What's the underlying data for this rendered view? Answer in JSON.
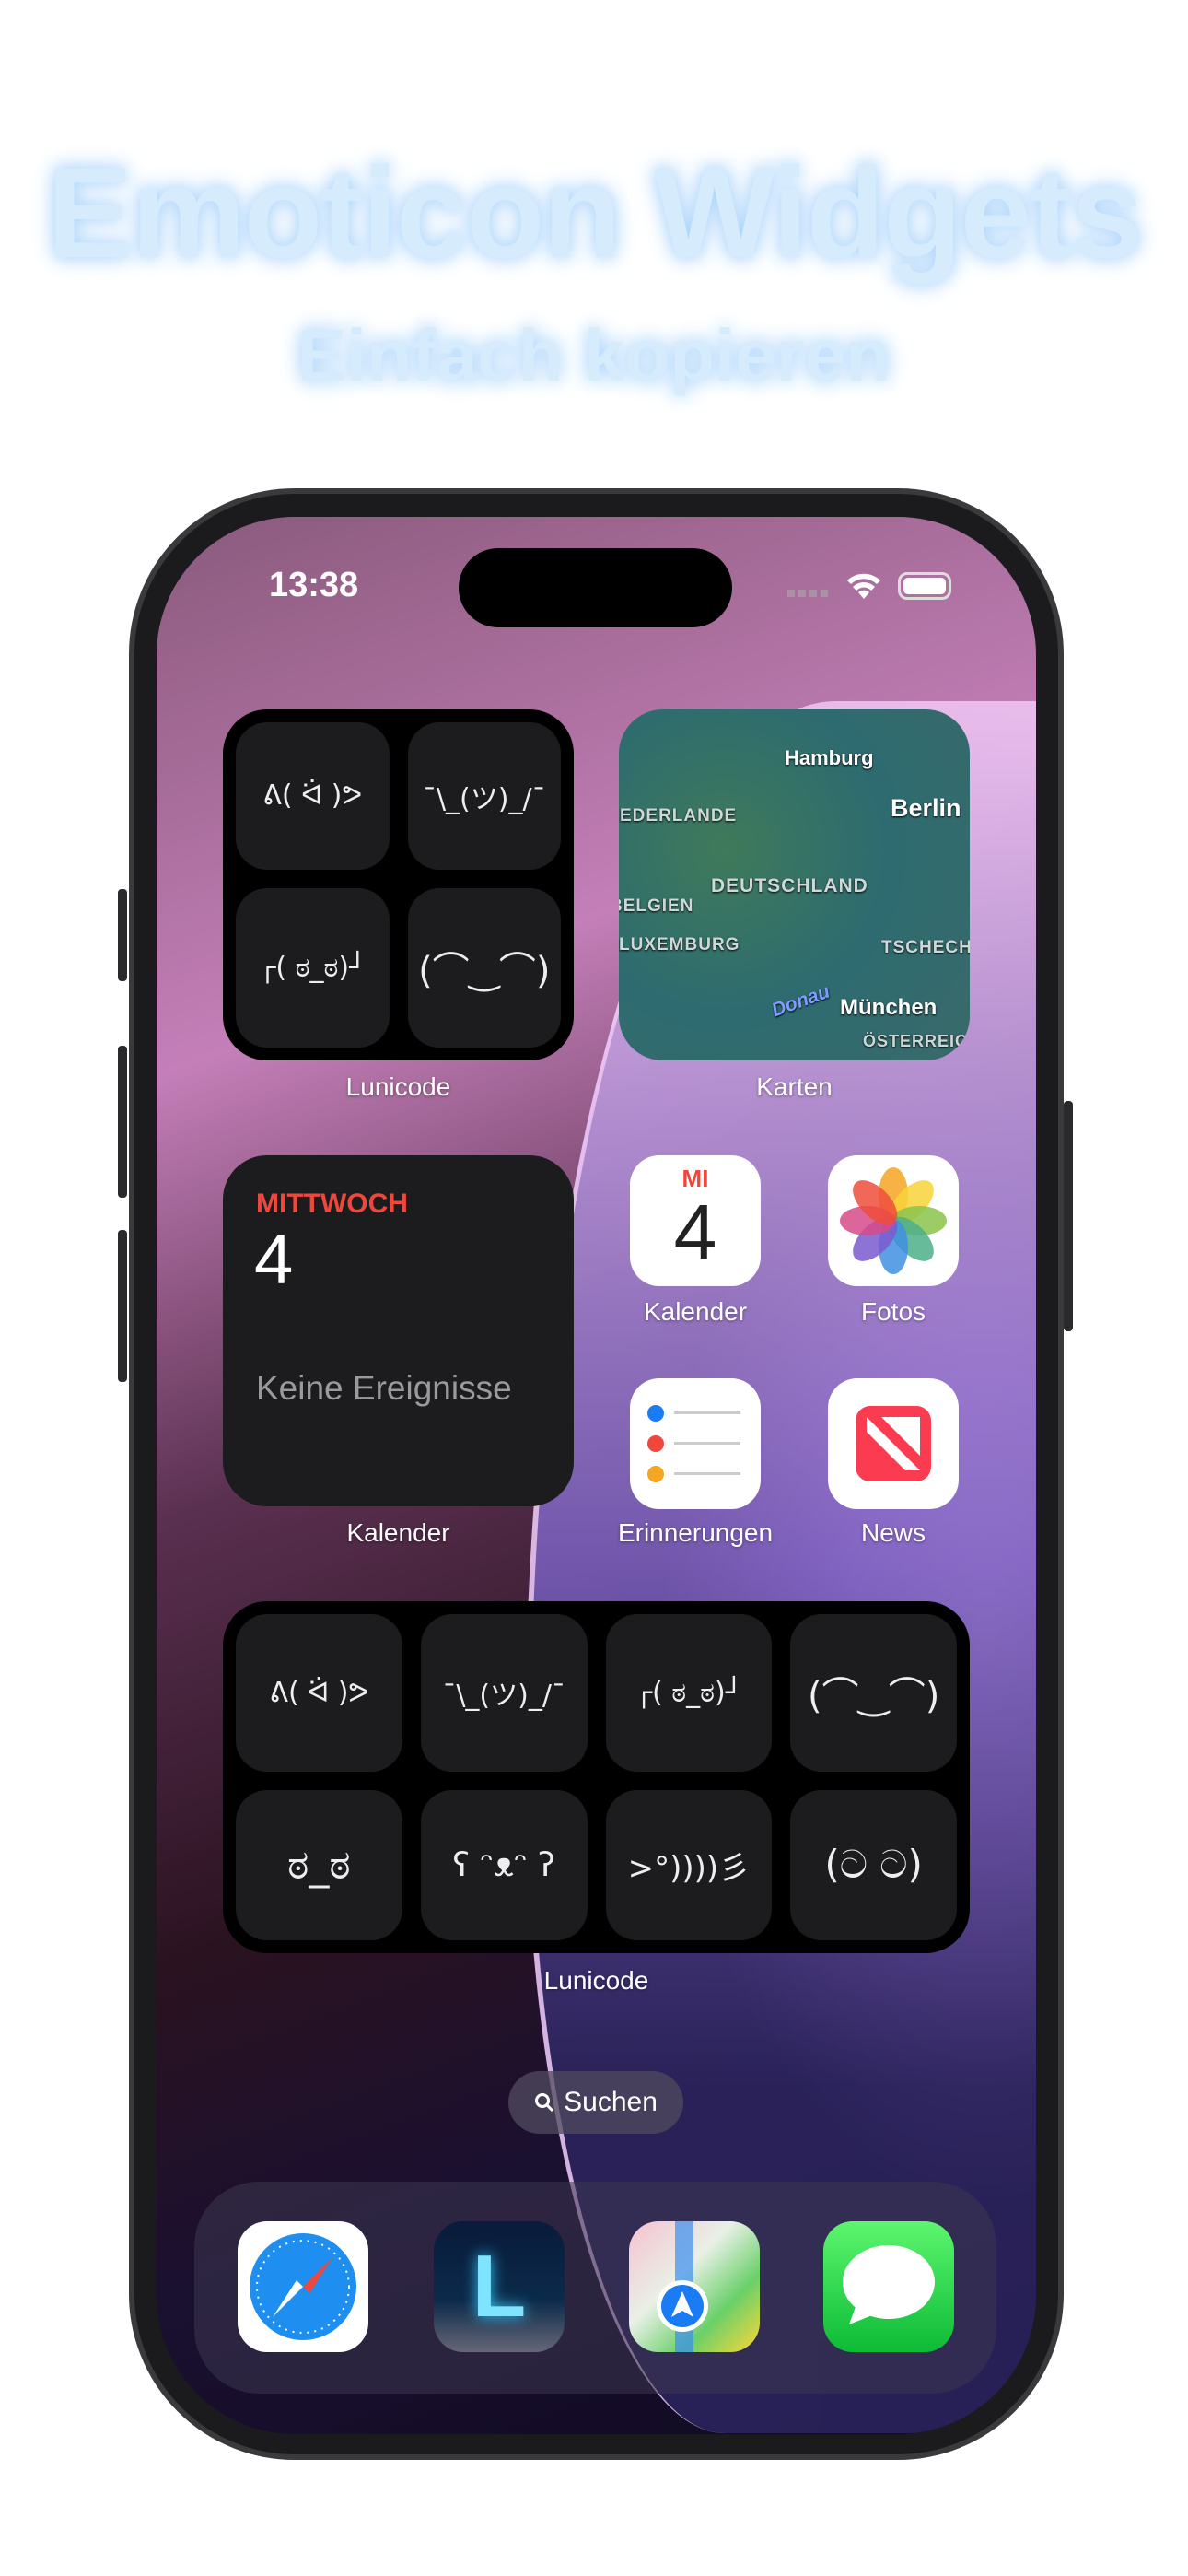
{
  "header": {
    "title": "Emoticon Widgets",
    "subtitle": "Einfach kopieren"
  },
  "status_bar": {
    "time": "13:38",
    "icons": [
      "signal-icon",
      "wifi-icon",
      "battery-icon"
    ]
  },
  "widgets": {
    "lunicode_small": {
      "label": "Lunicode",
      "emoticons": [
        "ᕕ( ᐛ )ᕗ",
        "¯\\_(ツ)_/¯",
        "┌( ಠ_ಠ)┘",
        "(⌒‿⌒)"
      ]
    },
    "maps": {
      "label": "Karten",
      "places": [
        "Hamburg",
        "Berlin",
        "DEUTSCHLAND",
        "NIEDERLANDE",
        "BELGIEN",
        "LUXEMBURG",
        "TSCHECHIEN",
        "München",
        "ÖSTERREICH",
        "Donau"
      ]
    },
    "calendar": {
      "label": "Kalender",
      "weekday": "MITTWOCH",
      "day": "4",
      "empty_text": "Keine Ereignisse"
    },
    "lunicode_large": {
      "label": "Lunicode",
      "emoticons": [
        "ᕕ( ᐛ )ᕗ",
        "¯\\_(ツ)_/¯",
        "┌( ಠ_ಠ)┘",
        "(⌒‿⌒)",
        "ಠ_ಠ",
        "ʕ ᵔᴥᵔ ʔ",
        ">°))))彡",
        "(ට ට)"
      ]
    }
  },
  "apps": [
    {
      "label": "Kalender",
      "icon": "calendar-icon",
      "weekday": "MI",
      "day": "4"
    },
    {
      "label": "Fotos",
      "icon": "photos-icon"
    },
    {
      "label": "Erinnerungen",
      "icon": "reminders-icon"
    },
    {
      "label": "News",
      "icon": "news-icon"
    }
  ],
  "search": {
    "label": "Suchen"
  },
  "dock": [
    {
      "icon": "safari-icon"
    },
    {
      "icon": "lunicode-icon",
      "letter": "L"
    },
    {
      "icon": "maps-icon"
    },
    {
      "icon": "messages-icon"
    }
  ],
  "colors": {
    "calendar_red": "#f0463c",
    "title_glow": "#a9d3fb"
  }
}
